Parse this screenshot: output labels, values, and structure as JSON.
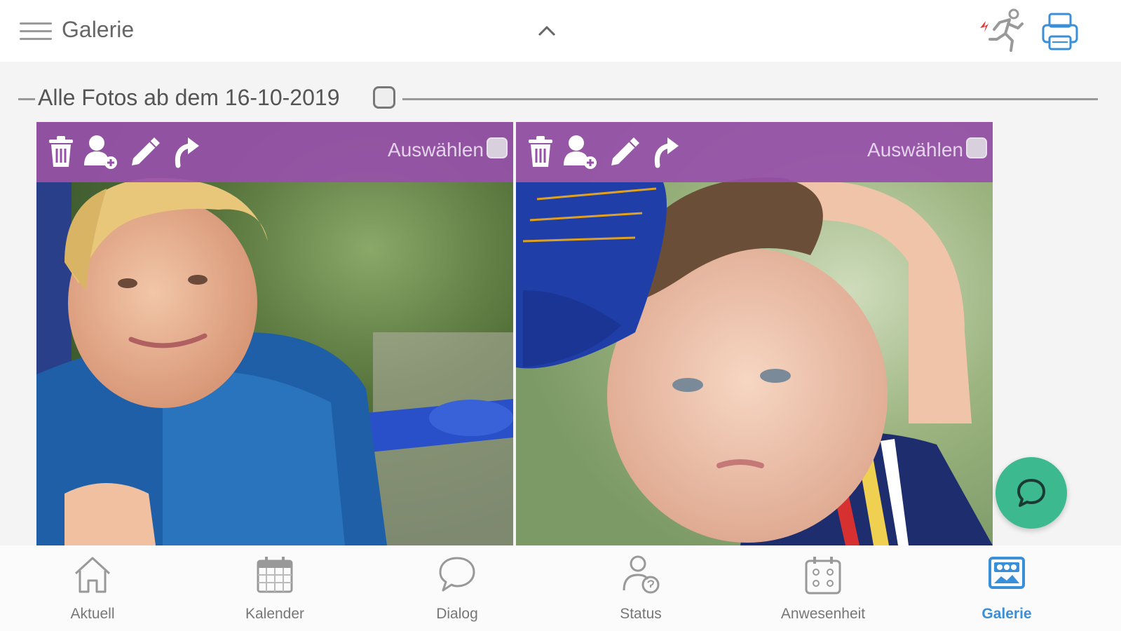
{
  "header": {
    "title": "Galerie",
    "icons": {
      "menu": "hamburger-menu-icon",
      "collapse": "chevron-up-icon",
      "exit": "emergency-exit-icon",
      "print": "printer-icon"
    }
  },
  "section": {
    "title": "Alle Fotos ab dem 16-10-2019",
    "select_all_checked": false
  },
  "photos": [
    {
      "select_label": "Auswählen",
      "selected": false,
      "subject": "smiling blond boy in blue jacket on playground"
    },
    {
      "select_label": "Auswählen",
      "selected": false,
      "subject": "toddler in blue cap with raised arm"
    }
  ],
  "photo_actions": [
    "trash-icon",
    "add-person-icon",
    "pencil-icon",
    "rotate-icon"
  ],
  "fab": {
    "icon": "chat-bubble-icon",
    "color": "#3cb98e"
  },
  "nav": {
    "items": [
      {
        "label": "Aktuell",
        "icon": "home-icon",
        "active": false
      },
      {
        "label": "Kalender",
        "icon": "calendar-icon",
        "active": false
      },
      {
        "label": "Dialog",
        "icon": "speech-bubble-icon",
        "active": false
      },
      {
        "label": "Status",
        "icon": "person-status-icon",
        "active": false
      },
      {
        "label": "Anwesenheit",
        "icon": "attendance-board-icon",
        "active": false
      },
      {
        "label": "Galerie",
        "icon": "gallery-icon",
        "active": true
      }
    ],
    "active_color": "#3a8fd9"
  },
  "colors": {
    "toolbar": "#9750aa",
    "accent": "#3a8fd9"
  }
}
